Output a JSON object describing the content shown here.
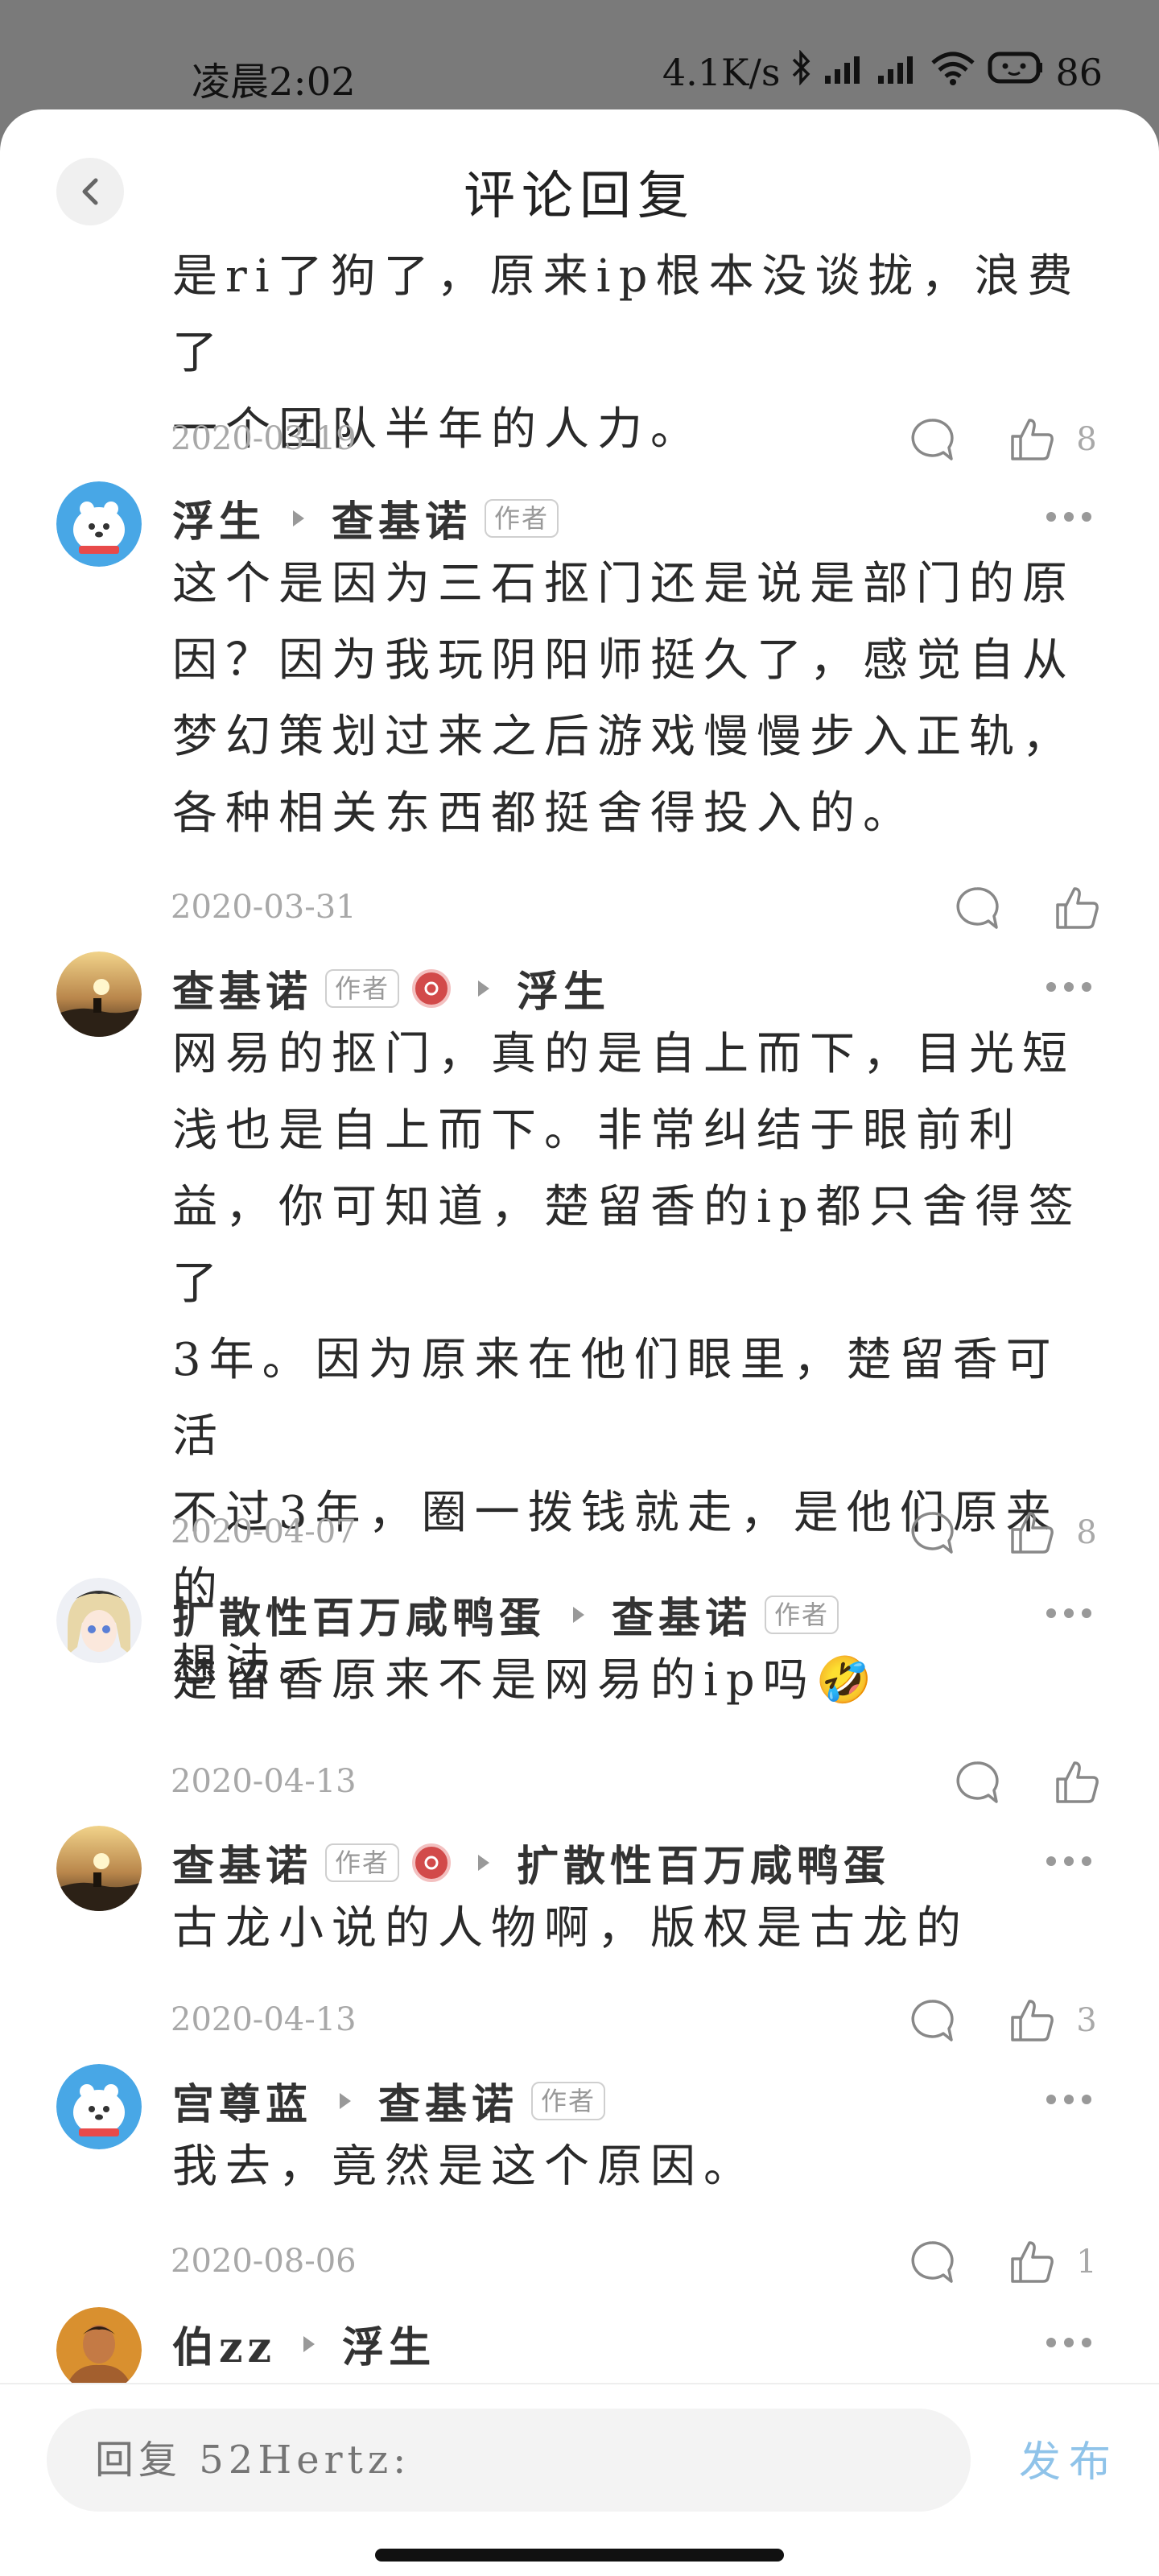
{
  "status_bar": {
    "time": "凌晨2:02",
    "network_speed": "4.1K/s",
    "battery": "86"
  },
  "header": {
    "title": "评论回复"
  },
  "top_snippet": {
    "text_lines": [
      "是ri了狗了，原来ip根本没谈拢，浪费了",
      "一个团队半年的人力。"
    ],
    "date": "2020-03-19",
    "likes": "8"
  },
  "replies": [
    {
      "user": "浮生",
      "reply_to": "查基诺",
      "user_is_author": false,
      "target_is_author": true,
      "text_lines": [
        "这个是因为三石抠门还是说是部门的原",
        "因？因为我玩阴阳师挺久了，感觉自从",
        "梦幻策划过来之后游戏慢慢步入正轨，",
        "各种相关东西都挺舍得投入的。"
      ],
      "date": "2020-03-31",
      "likes": ""
    },
    {
      "user": "查基诺",
      "reply_to": "浮生",
      "user_is_author": true,
      "target_is_author": false,
      "text_lines": [
        "网易的抠门，真的是自上而下，目光短",
        "浅也是自上而下。非常纠结于眼前利",
        "益，你可知道，楚留香的ip都只舍得签了",
        "3年。因为原来在他们眼里，楚留香可活",
        "不过3年，圈一拨钱就走，是他们原来的",
        "想法。"
      ],
      "date": "2020-04-07",
      "likes": "8"
    },
    {
      "user": "扩散性百万咸鸭蛋",
      "reply_to": "查基诺",
      "user_is_author": false,
      "target_is_author": true,
      "text_lines": [
        "楚留香原来不是网易的ip吗🤣"
      ],
      "date": "2020-04-13",
      "likes": ""
    },
    {
      "user": "查基诺",
      "reply_to": "扩散性百万咸鸭蛋",
      "user_is_author": true,
      "target_is_author": false,
      "text_lines": [
        "古龙小说的人物啊，版权是古龙的"
      ],
      "date": "2020-04-13",
      "likes": "3"
    },
    {
      "user": "宫尊蓝",
      "reply_to": "查基诺",
      "user_is_author": false,
      "target_is_author": true,
      "text_lines": [
        "我去，竟然是这个原因。"
      ],
      "date": "2020-08-06",
      "likes": "1"
    },
    {
      "user": "伯zz",
      "reply_to": "浮生",
      "user_is_author": false,
      "target_is_author": false,
      "text_lines": [],
      "date": "",
      "likes": ""
    }
  ],
  "author_tag": "作者",
  "bottom": {
    "reply_placeholder": "回复 52Hertz:",
    "publish_label": "发布"
  }
}
